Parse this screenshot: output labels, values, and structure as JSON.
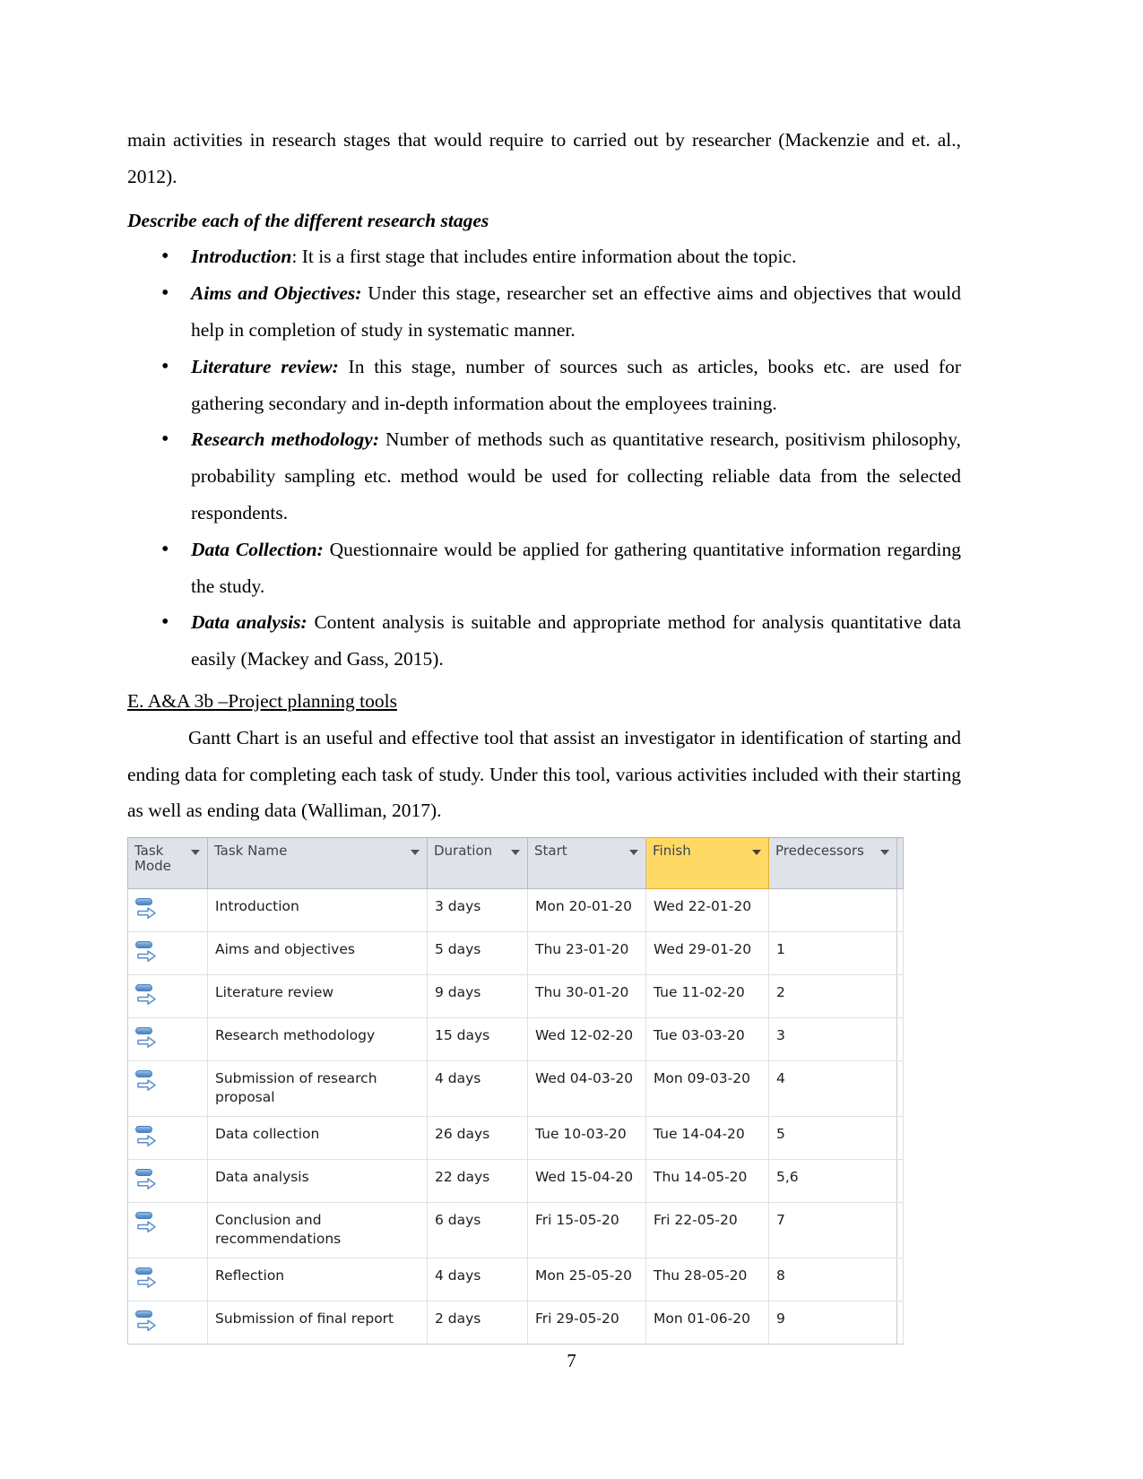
{
  "document": {
    "page_number": "7",
    "paragraphs": {
      "intro_para": "main activities in research stages that would require to carried out  by researcher  (Mackenzie and et. al., 2012).",
      "stages_heading": "Describe each of the different research stages",
      "section_heading": "E. A&A 3b –Project planning tools",
      "gantt_para": "Gantt Chart is an useful and effective tool that assist an investigator in identification of starting and ending data for completing each task of study. Under this tool, various activities included with their starting as well as ending data  (Walliman, 2017)."
    },
    "stages": [
      {
        "term": "Introduction",
        "separator": ": ",
        "text": "It is a first stage that includes entire information about the topic."
      },
      {
        "term": "Aims and Objectives:",
        "separator": " ",
        "text": "Under this stage, researcher set an effective aims and objectives that would help in completion of study in systematic manner."
      },
      {
        "term": "Literature review:",
        "separator": " ",
        "text": "In this stage, number of sources such as articles, books etc. are used for gathering secondary and in-depth information about the employees training."
      },
      {
        "term": "Research methodology:",
        "separator": " ",
        "text": "Number of methods such as quantitative research, positivism philosophy, probability sampling etc. method would be used for collecting reliable data from the selected respondents."
      },
      {
        "term": "Data Collection:",
        "separator": " ",
        "text": "Questionnaire would be applied for gathering quantitative information regarding the study."
      },
      {
        "term": "Data analysis:",
        "separator": " ",
        "text": "Content analysis is suitable and appropriate method for analysis quantitative data easily  (Mackey and Gass, 2015)."
      }
    ],
    "bullet_glyph": "•"
  },
  "project_table": {
    "columns": [
      {
        "key": "task_mode",
        "label": "Task Mode",
        "highlighted": false
      },
      {
        "key": "task_name",
        "label": "Task Name",
        "highlighted": false
      },
      {
        "key": "duration",
        "label": "Duration",
        "highlighted": false
      },
      {
        "key": "start",
        "label": "Start",
        "highlighted": false
      },
      {
        "key": "finish",
        "label": "Finish",
        "highlighted": true
      },
      {
        "key": "predecessors",
        "label": "Predecessors",
        "highlighted": false
      }
    ],
    "header_highlight_color": "#ffd966",
    "header_background_color": "#dfe3e8",
    "task_mode_icon": "auto-scheduled-icon",
    "rows": [
      {
        "task_name": "Introduction",
        "duration": "3 days",
        "start": "Mon 20-01-20",
        "finish": "Wed 22-01-20",
        "predecessors": ""
      },
      {
        "task_name": "Aims and objectives",
        "duration": "5 days",
        "start": "Thu 23-01-20",
        "finish": "Wed 29-01-20",
        "predecessors": "1"
      },
      {
        "task_name": "Literature review",
        "duration": "9 days",
        "start": "Thu 30-01-20",
        "finish": "Tue 11-02-20",
        "predecessors": "2"
      },
      {
        "task_name": "Research methodology",
        "duration": "15 days",
        "start": "Wed 12-02-20",
        "finish": "Tue 03-03-20",
        "predecessors": "3"
      },
      {
        "task_name": "Submission of research proposal",
        "duration": "4 days",
        "start": "Wed 04-03-20",
        "finish": "Mon 09-03-20",
        "predecessors": "4"
      },
      {
        "task_name": "Data collection",
        "duration": "26 days",
        "start": "Tue 10-03-20",
        "finish": "Tue 14-04-20",
        "predecessors": "5"
      },
      {
        "task_name": "Data analysis",
        "duration": "22 days",
        "start": "Wed 15-04-20",
        "finish": "Thu 14-05-20",
        "predecessors": "5,6"
      },
      {
        "task_name": "Conclusion and recommendations",
        "duration": "6 days",
        "start": "Fri 15-05-20",
        "finish": "Fri 22-05-20",
        "predecessors": "7"
      },
      {
        "task_name": "Reflection",
        "duration": "4 days",
        "start": "Mon 25-05-20",
        "finish": "Thu 28-05-20",
        "predecessors": "8"
      },
      {
        "task_name": "Submission of final report",
        "duration": "2 days",
        "start": "Fri 29-05-20",
        "finish": "Mon 01-06-20",
        "predecessors": "9"
      }
    ]
  }
}
